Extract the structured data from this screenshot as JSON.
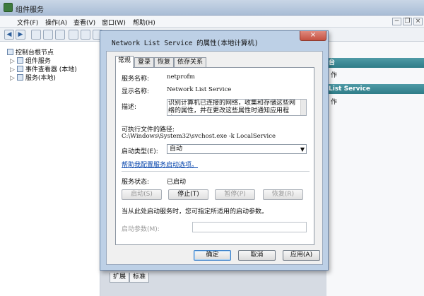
{
  "window": {
    "title": "组件服务"
  },
  "menu": [
    {
      "label": "文件(F)"
    },
    {
      "label": "操作(A)"
    },
    {
      "label": "查看(V)"
    },
    {
      "label": "窗口(W)"
    },
    {
      "label": "帮助(H)"
    }
  ],
  "window_buttons": {
    "minimize": "−",
    "restore": "❐",
    "close": "×"
  },
  "toolbar": {
    "back": "◀",
    "forward": "▶"
  },
  "tree": {
    "root": "控制台根节点",
    "items": [
      "组件服务",
      "事件查看器 (本地)",
      "服务(本地)"
    ]
  },
  "right_pane": {
    "header1": "台",
    "row1": "作",
    "header2": "List Service",
    "row2": "作"
  },
  "bottom_tabs": [
    "扩展",
    "标准"
  ],
  "dialog": {
    "title": "Network List Service 的属性(本地计算机)",
    "close": "×",
    "tabs": [
      "常规",
      "登录",
      "恢复",
      "依存关系"
    ],
    "service_name_label": "服务名称:",
    "service_name": "netprofm",
    "display_name_label": "显示名称:",
    "display_name": "Network List Service",
    "description_label": "描述:",
    "description": "识别计算机已连接的网络，收集和存储这些网络的属性，并在更改这些属性时通知应用程序。",
    "exe_path_label": "可执行文件的路径:",
    "exe_path": "C:\\Windows\\System32\\svchost.exe -k LocalService",
    "startup_type_label": "启动类型(E):",
    "startup_type": "自动",
    "help_link": "帮助我配置服务启动选项。",
    "status_label": "服务状态:",
    "status": "已启动",
    "buttons": {
      "start": "启动(S)",
      "stop": "停止(T)",
      "pause": "暂停(P)",
      "resume": "恢复(R)"
    },
    "hint": "当从此处启动服务时，您可指定所适用的启动参数。",
    "params_label": "启动参数(M):",
    "ok": "确定",
    "cancel": "取消",
    "apply": "应用(A)"
  }
}
